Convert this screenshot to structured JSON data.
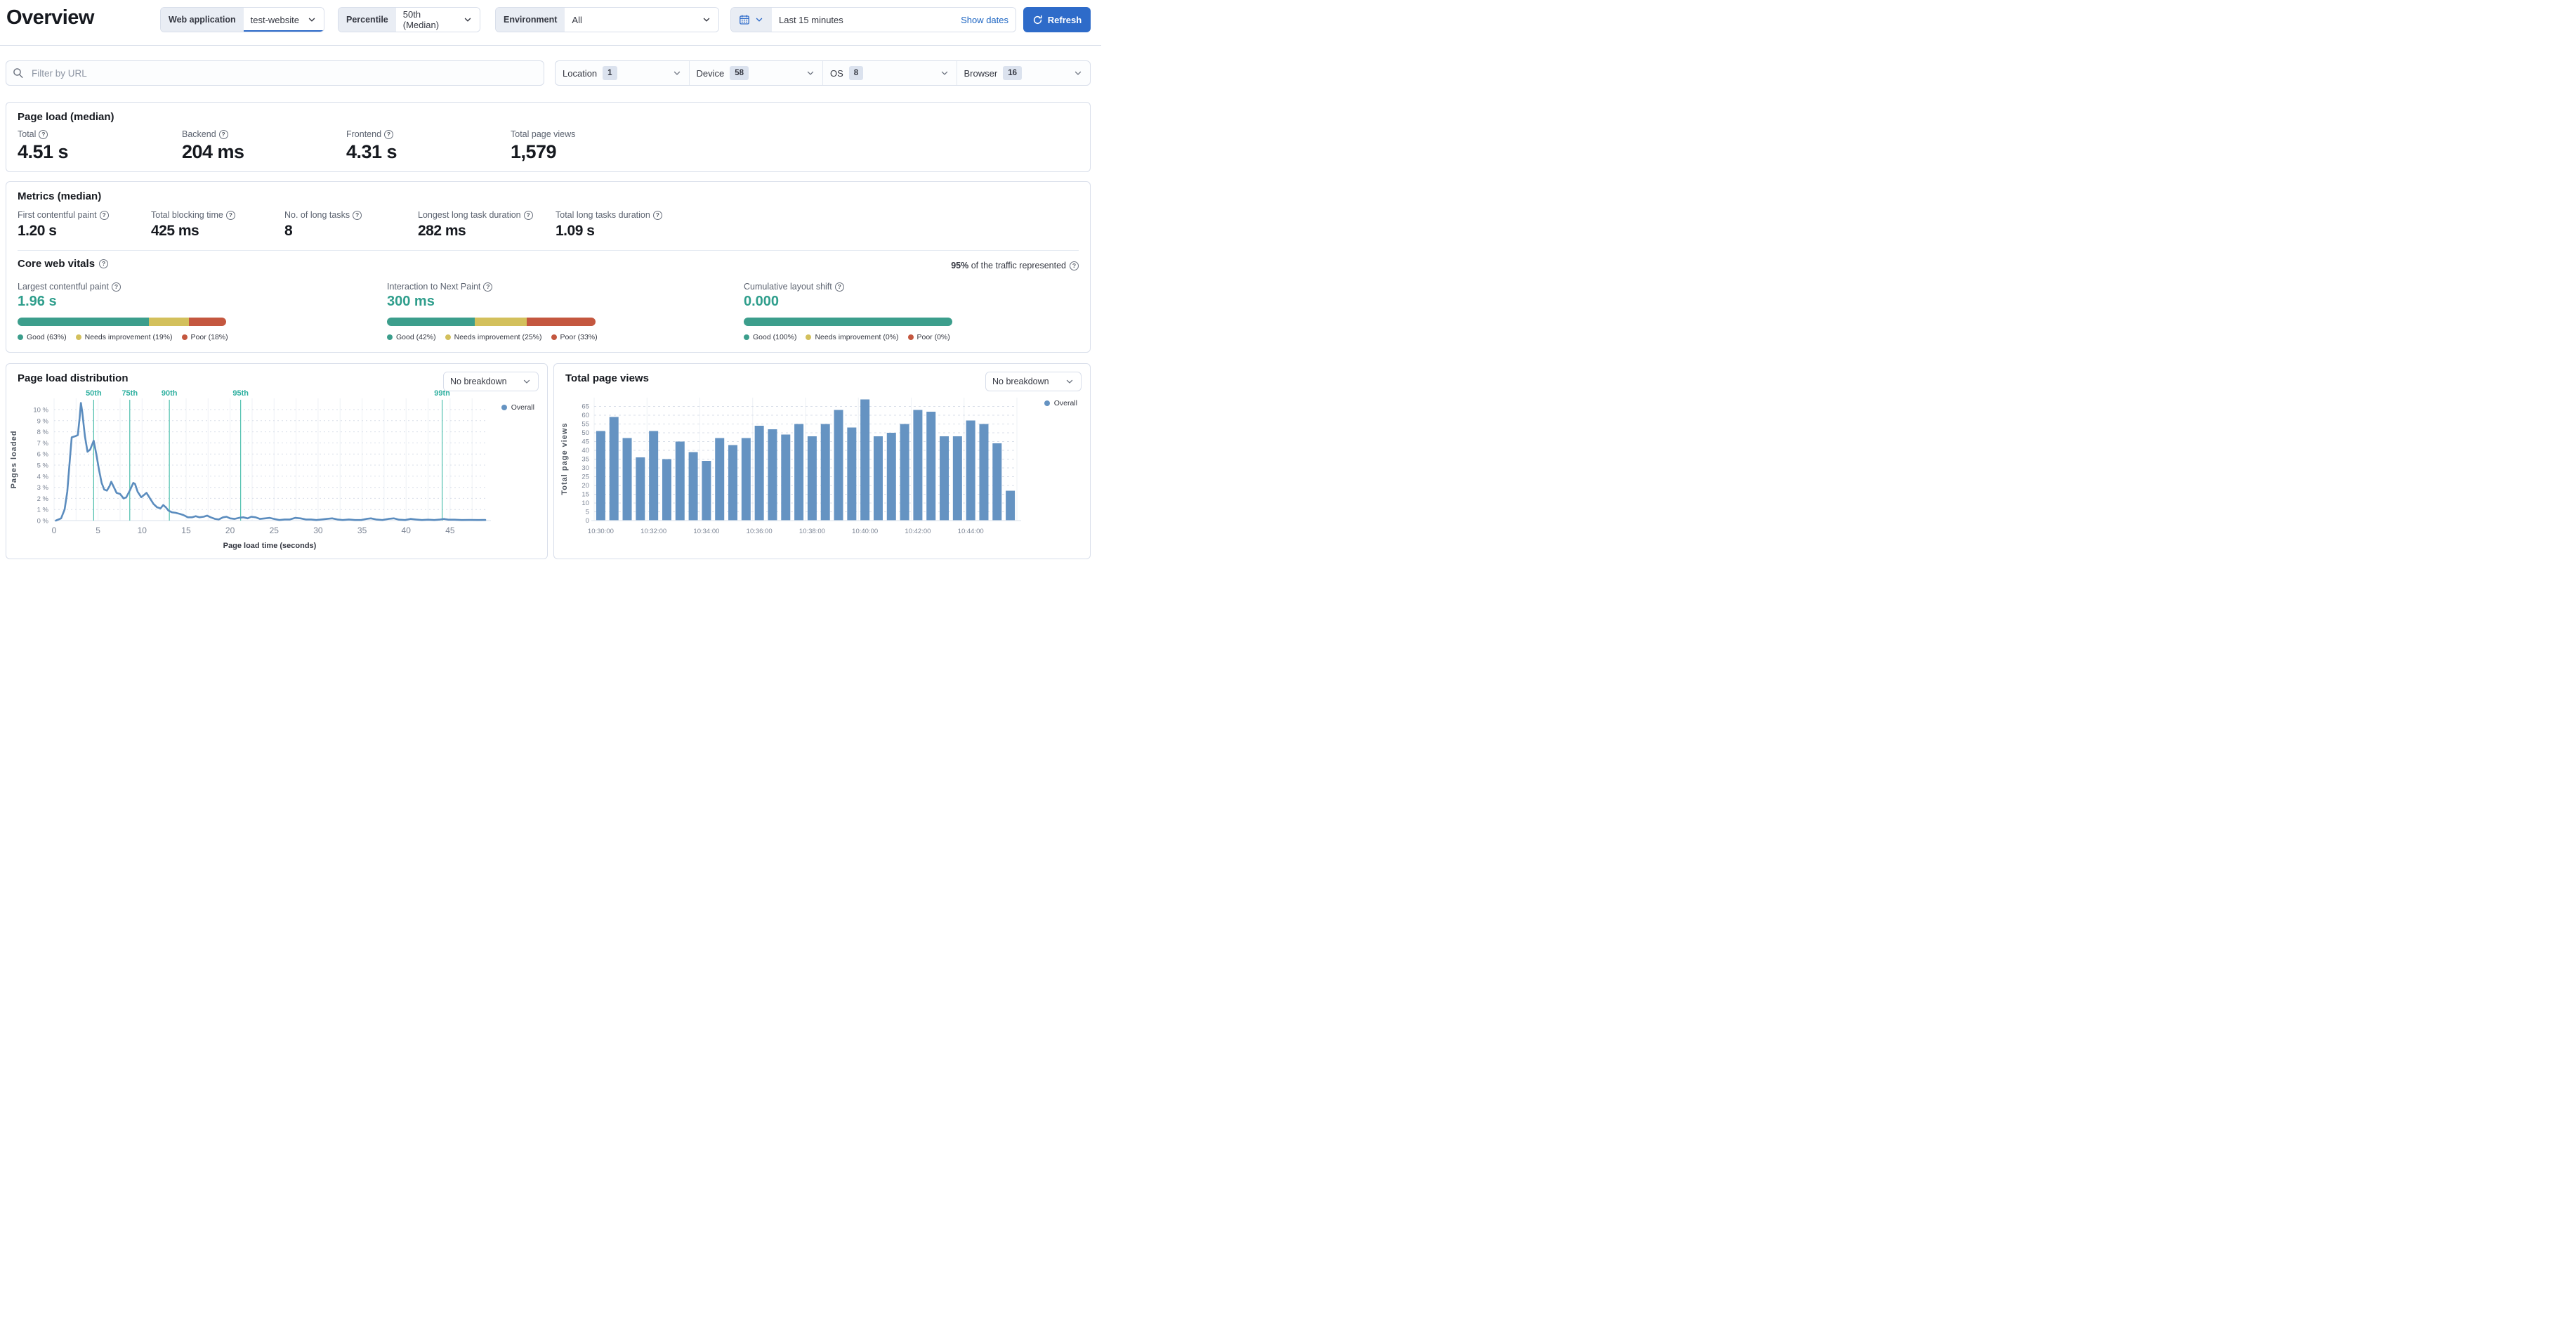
{
  "header": {
    "page_title": "Overview",
    "web_application": {
      "label": "Web application",
      "value": "test-website"
    },
    "percentile": {
      "label": "Percentile",
      "value": "50th (Median)"
    },
    "environment": {
      "label": "Environment",
      "value": "All"
    },
    "time_range": {
      "value": "Last 15 minutes",
      "show_dates": "Show dates"
    },
    "refresh_label": "Refresh"
  },
  "filters": {
    "url_placeholder": "Filter by URL",
    "dropdowns": [
      {
        "label": "Location",
        "count": "1"
      },
      {
        "label": "Device",
        "count": "58"
      },
      {
        "label": "OS",
        "count": "8"
      },
      {
        "label": "Browser",
        "count": "16"
      }
    ]
  },
  "page_load": {
    "title": "Page load (median)",
    "stats": [
      {
        "label": "Total",
        "value": "4.51 s"
      },
      {
        "label": "Backend",
        "value": "204 ms"
      },
      {
        "label": "Frontend",
        "value": "4.31 s"
      },
      {
        "label": "Total page views",
        "value": "1,579"
      }
    ]
  },
  "metrics": {
    "title": "Metrics (median)",
    "stats": [
      {
        "label": "First contentful paint",
        "value": "1.20 s"
      },
      {
        "label": "Total blocking time",
        "value": "425 ms"
      },
      {
        "label": "No. of long tasks",
        "value": "8"
      },
      {
        "label": "Longest long task duration",
        "value": "282 ms"
      },
      {
        "label": "Total long tasks duration",
        "value": "1.09 s"
      }
    ]
  },
  "core_web_vitals": {
    "title": "Core web vitals",
    "traffic_strong": "95%",
    "traffic_rest": " of the traffic represented",
    "vitals": [
      {
        "label": "Largest contentful paint",
        "value": "1.96 s",
        "good": 63,
        "needs_improvement": 19,
        "poor": 18,
        "legend": [
          "Good (63%)",
          "Needs improvement (19%)",
          "Poor (18%)"
        ]
      },
      {
        "label": "Interaction to Next Paint",
        "value": "300 ms",
        "good": 42,
        "needs_improvement": 25,
        "poor": 33,
        "legend": [
          "Good (42%)",
          "Needs improvement (25%)",
          "Poor (33%)"
        ]
      },
      {
        "label": "Cumulative layout shift",
        "value": "0.000",
        "good": 100,
        "needs_improvement": 0,
        "poor": 0,
        "legend": [
          "Good (100%)",
          "Needs improvement (0%)",
          "Poor (0%)"
        ]
      }
    ]
  },
  "chart_data": [
    {
      "type": "line",
      "title": "Page load distribution",
      "breakdown": "No breakdown",
      "legend": "Overall",
      "xlabel": "Page load time (seconds)",
      "ylabel": "Pages loaded",
      "xlim": [
        0,
        49
      ],
      "x_ticks": [
        0,
        5,
        10,
        15,
        20,
        25,
        30,
        35,
        40,
        45
      ],
      "y_ticks_pct": [
        0,
        1,
        2,
        3,
        4,
        5,
        6,
        7,
        8,
        9,
        10
      ],
      "percentile_markers": [
        {
          "label": "50th",
          "x": 4.5
        },
        {
          "label": "75th",
          "x": 8.6
        },
        {
          "label": "90th",
          "x": 13.1
        },
        {
          "label": "95th",
          "x": 21.2
        },
        {
          "label": "99th",
          "x": 44.1
        }
      ],
      "points": [
        [
          0.2,
          0
        ],
        [
          0.8,
          0.2
        ],
        [
          1.2,
          1.0
        ],
        [
          1.5,
          2.6
        ],
        [
          1.8,
          5.6
        ],
        [
          2.0,
          7.5
        ],
        [
          2.4,
          7.6
        ],
        [
          2.7,
          7.7
        ],
        [
          2.9,
          9.2
        ],
        [
          3.05,
          10.6
        ],
        [
          3.2,
          9.8
        ],
        [
          3.5,
          7.6
        ],
        [
          3.8,
          6.2
        ],
        [
          4.1,
          6.4
        ],
        [
          4.5,
          7.2
        ],
        [
          4.8,
          6.0
        ],
        [
          5.1,
          4.6
        ],
        [
          5.4,
          3.4
        ],
        [
          5.7,
          2.8
        ],
        [
          6.0,
          2.7
        ],
        [
          6.3,
          3.1
        ],
        [
          6.5,
          3.5
        ],
        [
          6.8,
          3.0
        ],
        [
          7.1,
          2.5
        ],
        [
          7.5,
          2.4
        ],
        [
          7.9,
          2.0
        ],
        [
          8.2,
          2.1
        ],
        [
          8.6,
          2.7
        ],
        [
          9.0,
          3.4
        ],
        [
          9.2,
          3.3
        ],
        [
          9.5,
          2.6
        ],
        [
          9.9,
          2.1
        ],
        [
          10.2,
          2.3
        ],
        [
          10.5,
          2.5
        ],
        [
          10.9,
          2.0
        ],
        [
          11.3,
          1.5
        ],
        [
          11.7,
          1.2
        ],
        [
          12.1,
          1.1
        ],
        [
          12.4,
          1.4
        ],
        [
          12.7,
          1.2
        ],
        [
          13.0,
          0.9
        ],
        [
          13.4,
          0.75
        ],
        [
          13.8,
          0.7
        ],
        [
          14.3,
          0.6
        ],
        [
          14.7,
          0.5
        ],
        [
          15.2,
          0.3
        ],
        [
          15.7,
          0.3
        ],
        [
          16.1,
          0.4
        ],
        [
          16.5,
          0.3
        ],
        [
          17.0,
          0.35
        ],
        [
          17.4,
          0.45
        ],
        [
          17.8,
          0.3
        ],
        [
          18.3,
          0.15
        ],
        [
          18.7,
          0.1
        ],
        [
          19.2,
          0.3
        ],
        [
          19.6,
          0.35
        ],
        [
          20.0,
          0.2
        ],
        [
          20.5,
          0.15
        ],
        [
          21.0,
          0.25
        ],
        [
          21.5,
          0.3
        ],
        [
          22.0,
          0.2
        ],
        [
          22.4,
          0.35
        ],
        [
          22.9,
          0.3
        ],
        [
          23.4,
          0.15
        ],
        [
          24.0,
          0.2
        ],
        [
          24.5,
          0.25
        ],
        [
          25.0,
          0.15
        ],
        [
          25.6,
          0.05
        ],
        [
          26.2,
          0.1
        ],
        [
          26.8,
          0.1
        ],
        [
          27.4,
          0.25
        ],
        [
          28.0,
          0.2
        ],
        [
          28.6,
          0.1
        ],
        [
          29.2,
          0.1
        ],
        [
          29.8,
          0.05
        ],
        [
          30.4,
          0.1
        ],
        [
          31.0,
          0.15
        ],
        [
          31.6,
          0.2
        ],
        [
          32.2,
          0.1
        ],
        [
          32.8,
          0.05
        ],
        [
          33.5,
          0.1
        ],
        [
          34.2,
          0.05
        ],
        [
          34.9,
          0.05
        ],
        [
          35.5,
          0.15
        ],
        [
          36.0,
          0.2
        ],
        [
          36.6,
          0.1
        ],
        [
          37.3,
          0.05
        ],
        [
          38.0,
          0.15
        ],
        [
          38.6,
          0.2
        ],
        [
          39.2,
          0.08
        ],
        [
          39.9,
          0.05
        ],
        [
          40.5,
          0.15
        ],
        [
          41.1,
          0.1
        ],
        [
          41.8,
          0.05
        ],
        [
          42.5,
          0.08
        ],
        [
          43.2,
          0.05
        ],
        [
          43.9,
          0.1
        ],
        [
          44.3,
          0.15
        ],
        [
          44.8,
          0.08
        ],
        [
          45.5,
          0.08
        ],
        [
          46.3,
          0.05
        ],
        [
          47.2,
          0.06
        ],
        [
          48.2,
          0.05
        ],
        [
          49.0,
          0.06
        ]
      ]
    },
    {
      "type": "bar",
      "title": "Total page views",
      "breakdown": "No breakdown",
      "legend": "Overall",
      "ylabel": "Total page views",
      "y_ticks": [
        0,
        5,
        10,
        15,
        20,
        25,
        30,
        35,
        40,
        45,
        50,
        55,
        60,
        65
      ],
      "x_tick_labels": [
        "10:30:00",
        "10:32:00",
        "10:34:00",
        "10:36:00",
        "10:38:00",
        "10:40:00",
        "10:42:00",
        "10:44:00"
      ],
      "x_tick_every": 4,
      "values": [
        51,
        59,
        47,
        36,
        51,
        35,
        45,
        39,
        34,
        47,
        43,
        47,
        54,
        52,
        49,
        55,
        48,
        55,
        63,
        53,
        69,
        48,
        50,
        55,
        63,
        62,
        48,
        48,
        57,
        55,
        44,
        17
      ]
    }
  ],
  "colors": {
    "accent_blue": "#2e6bc9",
    "link_blue": "#1b64c2",
    "series_blue": "#6593c2",
    "line_blue": "#5b8cbe",
    "good": "#3c9e8c",
    "needs_improvement": "#d3c05c",
    "poor": "#c4573f",
    "vital_value": "#2f9e8c",
    "marker_teal": "#4fc0ae",
    "marker_label_teal": "#2fb0a0",
    "grid_dash": "#d9dfe9",
    "grid_solid": "#eef1f6",
    "axis_text": "#7b8494"
  }
}
